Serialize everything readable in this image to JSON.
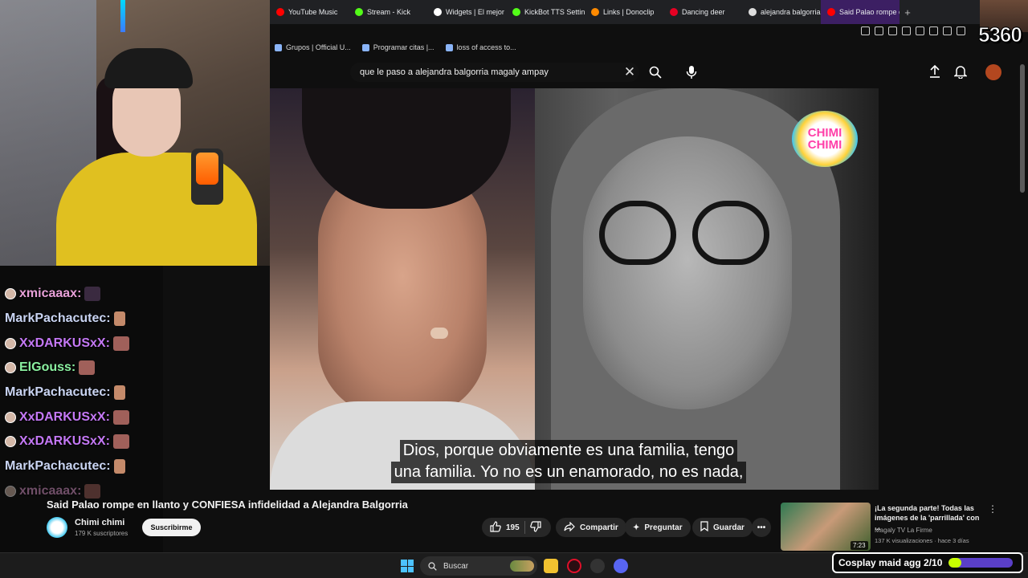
{
  "browser": {
    "tabs": [
      {
        "label": "YouTube Music",
        "icon_color": "#ff0000"
      },
      {
        "label": "Stream - Kick",
        "icon_color": "#53fc18"
      },
      {
        "label": "Widgets | El mejor",
        "icon_color": "#ffffff"
      },
      {
        "label": "KickBot TTS Settings",
        "icon_color": "#53fc18"
      },
      {
        "label": "Links | Donoclip",
        "icon_color": "#ff8a00"
      },
      {
        "label": "Dancing deer",
        "icon_color": "#e60023"
      },
      {
        "label": "alejandra balgorria",
        "icon_color": "#dddddd"
      },
      {
        "label": "Said Palao rompe en llanto",
        "icon_color": "#ff0000",
        "active": true
      }
    ],
    "bookmarks": [
      "Grupos | Official U...",
      "Programar citas |...",
      "loss of access to..."
    ]
  },
  "youtube": {
    "search_query": "que le paso a alejandra balgorria magaly ampay",
    "video": {
      "overlay_logo": "CHIMI CHIMI",
      "subtitle_line1": "Dios, porque obviamente es una familia, tengo",
      "subtitle_line2": "una familia. Yo no es un enamorado, no es nada,",
      "title": "Said Palao rompe en llanto y CONFIESA infidelidad a Alejandra Balgorria",
      "channel_name": "Chimi chimi",
      "subscribers": "179 K suscriptores",
      "subscribe_label": "Suscribirme",
      "likes": "195",
      "share_label": "Compartir",
      "ask_label": "Preguntar",
      "save_label": "Guardar"
    },
    "recommended": {
      "title": "¡La segunda parte! Todas las imágenes de la 'parrillada' con ...",
      "channel": "Magaly TV La Firme",
      "meta": "137 K visualizaciones · hace 3 días",
      "duration": "7:23"
    }
  },
  "stream_overlay": {
    "counter": "5360",
    "chat": [
      {
        "user": "xmicaaax:",
        "color": "#e8a0d8",
        "badge": true
      },
      {
        "user": "MarkPachacutec:",
        "color": "#c9d4f2",
        "badge": false
      },
      {
        "user": "XxDARKUSxX:",
        "color": "#c478f5",
        "badge": true
      },
      {
        "user": "ElGouss:",
        "color": "#8af0a0",
        "badge": true
      },
      {
        "user": "MarkPachacutec:",
        "color": "#c9d4f2",
        "badge": false
      },
      {
        "user": "XxDARKUSxX:",
        "color": "#c478f5",
        "badge": true
      },
      {
        "user": "XxDARKUSxX:",
        "color": "#c478f5",
        "badge": true
      },
      {
        "user": "MarkPachacutec:",
        "color": "#c9d4f2",
        "badge": false
      },
      {
        "user": "xmicaaax:",
        "color": "#e8a0d8",
        "badge": true
      }
    ],
    "goal": {
      "label": "Cosplay maid agg 2/10",
      "progress": 0.2
    }
  },
  "taskbar": {
    "search_placeholder": "Buscar"
  }
}
